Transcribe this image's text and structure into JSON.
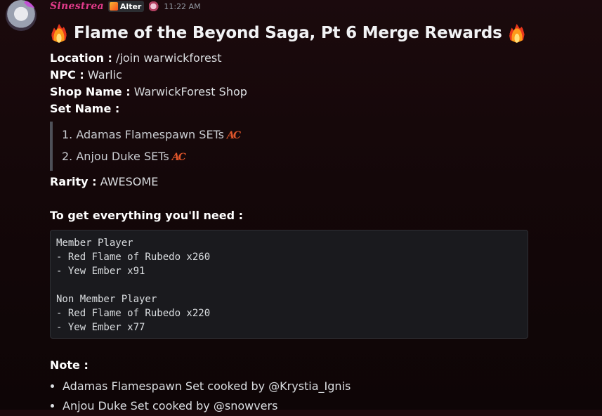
{
  "message": {
    "username": "Sinestrea",
    "tag": "Alter",
    "timestamp": "11:22 AM",
    "title": "Flame of the Beyond Saga, Pt 6 Merge Rewards",
    "fields": [
      {
        "label": "Location :",
        "value": "/join warwickforest"
      },
      {
        "label": "NPC :",
        "value": "Warlic"
      },
      {
        "label": "Shop Name :",
        "value": "WarwickForest Shop"
      },
      {
        "label": "Set Name :",
        "value": ""
      }
    ],
    "sets": [
      {
        "label": "1. Adamas Flamespawn SETs",
        "badge": "AC"
      },
      {
        "label": "2. Anjou Duke SETs",
        "badge": "AC"
      }
    ],
    "rarity": {
      "label": "Rarity :",
      "value": "AWESOME"
    },
    "need_heading": "To get everything you'll need :",
    "code_lines": [
      "Member Player",
      "- Red Flame of Rubedo x260",
      "- Yew Ember x91",
      "",
      "Non Member Player",
      "- Red Flame of Rubedo x220",
      "- Yew Ember x77"
    ],
    "note_heading": "Note :",
    "notes": [
      "Adamas Flamespawn Set cooked by @Krystia_Ignis",
      "Anjou Duke Set cooked by @snowvers"
    ]
  },
  "icons": {
    "title_emoji": "fire-icon",
    "ac": "ac-icon"
  },
  "colors": {
    "username": "#e23b8a",
    "background": "#140709",
    "codeblock_bg": "#1a1a1e"
  }
}
